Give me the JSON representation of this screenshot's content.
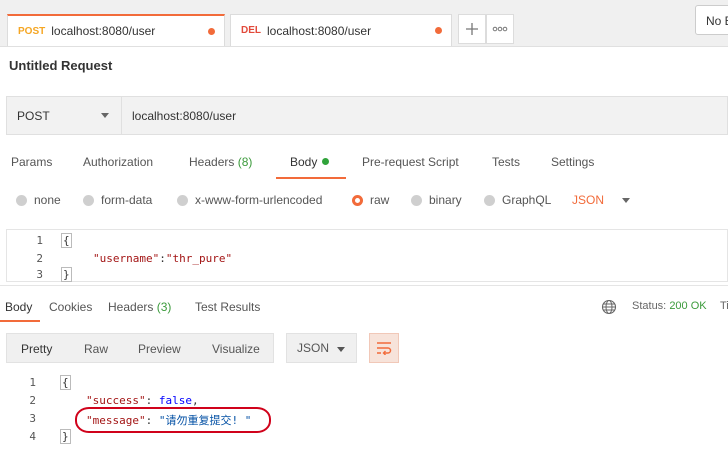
{
  "tabs": [
    {
      "method": "POST",
      "url": "localhost:8080/user",
      "active": true
    },
    {
      "method": "DEL",
      "url": "localhost:8080/user",
      "active": false
    }
  ],
  "env_selector": "No E",
  "request_title": "Untitled Request",
  "request": {
    "method": "POST",
    "url": "localhost:8080/user",
    "tabs": [
      {
        "label": "Params"
      },
      {
        "label": "Authorization"
      },
      {
        "label": "Headers",
        "count": "(8)"
      },
      {
        "label": "Body"
      },
      {
        "label": "Pre-request Script"
      },
      {
        "label": "Tests"
      },
      {
        "label": "Settings"
      }
    ],
    "body_types": [
      "none",
      "form-data",
      "x-www-form-urlencoded",
      "raw",
      "binary",
      "GraphQL"
    ],
    "selected_body_type": "raw",
    "format": "JSON",
    "body_lines": [
      {
        "num": "1",
        "text": "{"
      },
      {
        "num": "2",
        "key": "\"username\"",
        "sep": ":",
        "value": "\"thr_pure\""
      },
      {
        "num": "3",
        "text": "}"
      }
    ]
  },
  "response": {
    "tabs": [
      {
        "label": "Body"
      },
      {
        "label": "Cookies"
      },
      {
        "label": "Headers",
        "count": "(3)"
      },
      {
        "label": "Test Results"
      }
    ],
    "status_label": "Status:",
    "status_value": "200 OK",
    "time_label": "Ti",
    "view_modes": [
      "Pretty",
      "Raw",
      "Preview",
      "Visualize"
    ],
    "format": "JSON",
    "body_lines": [
      {
        "num": "1",
        "text": "{"
      },
      {
        "num": "2",
        "key": "\"success\"",
        "sep": ": ",
        "value": "false",
        "tail": ","
      },
      {
        "num": "3",
        "key": "\"message\"",
        "sep": ": ",
        "value": "\"请勿重复提交! \""
      },
      {
        "num": "4",
        "text": "}"
      }
    ]
  },
  "colors": {
    "accent": "#f26b3a",
    "post": "#f5a623",
    "del": "#e24a3b",
    "ok": "#3c9b3c",
    "highlight": "#d0021b"
  }
}
